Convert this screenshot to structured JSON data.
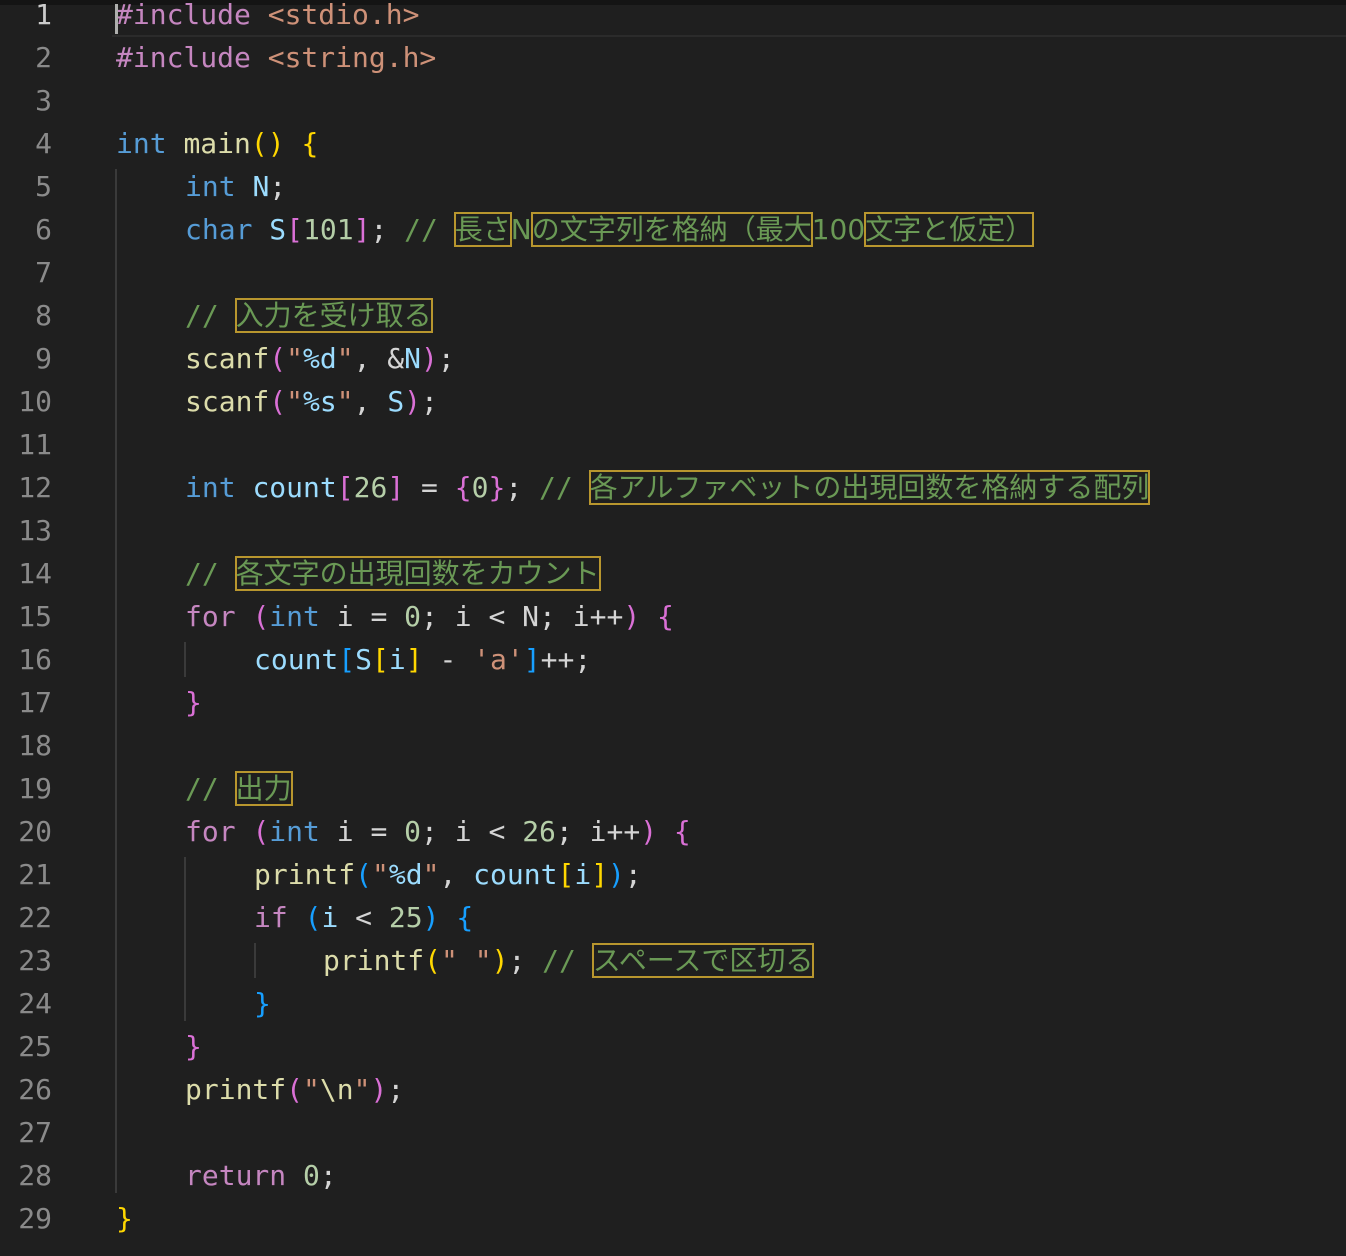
{
  "theme": {
    "background": "#1f1f1f",
    "colors": {
      "kw": "#569cd6",
      "ctl": "#c586c0",
      "fn": "#dcdcaa",
      "var": "#9cdcfe",
      "num": "#b5cea8",
      "str": "#ce9178",
      "cmt": "#6a9955",
      "pp": "#c586c0",
      "hdr": "#ce9178",
      "op": "#d4d4d4",
      "p1": "#ffd700",
      "p2": "#da70d6",
      "p3": "#179fff",
      "jp": "#6a9955"
    },
    "highlight_box": "#b8962e"
  },
  "editor": {
    "active_line": 1,
    "lines": [
      {
        "no": "1",
        "indent": 0,
        "tokens": [
          [
            "pp",
            "#include"
          ],
          [
            "op",
            " "
          ],
          [
            "hdr",
            "<stdio.h>"
          ]
        ]
      },
      {
        "no": "2",
        "indent": 0,
        "tokens": [
          [
            "pp",
            "#include"
          ],
          [
            "op",
            " "
          ],
          [
            "hdr",
            "<string.h>"
          ]
        ]
      },
      {
        "no": "3",
        "indent": 0,
        "tokens": []
      },
      {
        "no": "4",
        "indent": 0,
        "tokens": [
          [
            "kw",
            "int"
          ],
          [
            "op",
            " "
          ],
          [
            "fn",
            "main"
          ],
          [
            "p1",
            "()"
          ],
          [
            "op",
            " "
          ],
          [
            "p1",
            "{"
          ]
        ]
      },
      {
        "no": "5",
        "indent": 1,
        "tokens": [
          [
            "kw",
            "int"
          ],
          [
            "op",
            " "
          ],
          [
            "var",
            "N"
          ],
          [
            "op",
            ";"
          ]
        ]
      },
      {
        "no": "6",
        "indent": 1,
        "tokens": [
          [
            "kw",
            "char"
          ],
          [
            "op",
            " "
          ],
          [
            "var",
            "S"
          ],
          [
            "p2",
            "["
          ],
          [
            "num",
            "101"
          ],
          [
            "p2",
            "]"
          ],
          [
            "op",
            "; "
          ],
          [
            "cmt",
            "// "
          ],
          [
            "jpm",
            "長さ"
          ],
          [
            "jp",
            "N"
          ],
          [
            "jpm",
            "の文字列を格納（最大"
          ],
          [
            "jp",
            "100"
          ],
          [
            "jpm",
            "文字と仮定）"
          ]
        ]
      },
      {
        "no": "7",
        "indent": 1,
        "tokens": []
      },
      {
        "no": "8",
        "indent": 1,
        "tokens": [
          [
            "cmt",
            "// "
          ],
          [
            "jpm",
            "入力を受け取る"
          ]
        ]
      },
      {
        "no": "9",
        "indent": 1,
        "tokens": [
          [
            "fn",
            "scanf"
          ],
          [
            "p2",
            "("
          ],
          [
            "str",
            "\""
          ],
          [
            "var",
            "%d"
          ],
          [
            "str",
            "\""
          ],
          [
            "op",
            ", &"
          ],
          [
            "var",
            "N"
          ],
          [
            "p2",
            ")"
          ],
          [
            "op",
            ";"
          ]
        ]
      },
      {
        "no": "10",
        "indent": 1,
        "tokens": [
          [
            "fn",
            "scanf"
          ],
          [
            "p2",
            "("
          ],
          [
            "str",
            "\""
          ],
          [
            "var",
            "%s"
          ],
          [
            "str",
            "\""
          ],
          [
            "op",
            ", "
          ],
          [
            "var",
            "S"
          ],
          [
            "p2",
            ")"
          ],
          [
            "op",
            ";"
          ]
        ]
      },
      {
        "no": "11",
        "indent": 1,
        "tokens": []
      },
      {
        "no": "12",
        "indent": 1,
        "tokens": [
          [
            "kw",
            "int"
          ],
          [
            "op",
            " "
          ],
          [
            "var",
            "count"
          ],
          [
            "p2",
            "["
          ],
          [
            "num",
            "26"
          ],
          [
            "p2",
            "]"
          ],
          [
            "op",
            " = "
          ],
          [
            "p2",
            "{"
          ],
          [
            "num",
            "0"
          ],
          [
            "p2",
            "}"
          ],
          [
            "op",
            "; "
          ],
          [
            "cmt",
            "// "
          ],
          [
            "jpm",
            "各アルファベットの出現回数を格納する配列"
          ]
        ]
      },
      {
        "no": "13",
        "indent": 1,
        "tokens": []
      },
      {
        "no": "14",
        "indent": 1,
        "tokens": [
          [
            "cmt",
            "// "
          ],
          [
            "jpm",
            "各文字の出現回数をカウント"
          ]
        ]
      },
      {
        "no": "15",
        "indent": 1,
        "tokens": [
          [
            "ctl",
            "for"
          ],
          [
            "op",
            " "
          ],
          [
            "p2",
            "("
          ],
          [
            "kw",
            "int"
          ],
          [
            "op",
            " i = "
          ],
          [
            "num",
            "0"
          ],
          [
            "op",
            "; i < N; i++"
          ],
          [
            "p2",
            ")"
          ],
          [
            "op",
            " "
          ],
          [
            "p2",
            "{"
          ]
        ]
      },
      {
        "no": "16",
        "indent": 2,
        "tokens": [
          [
            "var",
            "count"
          ],
          [
            "p3",
            "["
          ],
          [
            "var",
            "S"
          ],
          [
            "p1",
            "["
          ],
          [
            "var",
            "i"
          ],
          [
            "p1",
            "]"
          ],
          [
            "op",
            " - "
          ],
          [
            "str",
            "'a'"
          ],
          [
            "p3",
            "]"
          ],
          [
            "op",
            "++;"
          ]
        ]
      },
      {
        "no": "17",
        "indent": 1,
        "tokens": [
          [
            "p2",
            "}"
          ]
        ]
      },
      {
        "no": "18",
        "indent": 1,
        "tokens": []
      },
      {
        "no": "19",
        "indent": 1,
        "tokens": [
          [
            "cmt",
            "// "
          ],
          [
            "jpm",
            "出力"
          ]
        ]
      },
      {
        "no": "20",
        "indent": 1,
        "tokens": [
          [
            "ctl",
            "for"
          ],
          [
            "op",
            " "
          ],
          [
            "p2",
            "("
          ],
          [
            "kw",
            "int"
          ],
          [
            "op",
            " i = "
          ],
          [
            "num",
            "0"
          ],
          [
            "op",
            "; i < "
          ],
          [
            "num",
            "26"
          ],
          [
            "op",
            "; i++"
          ],
          [
            "p2",
            ")"
          ],
          [
            "op",
            " "
          ],
          [
            "p2",
            "{"
          ]
        ]
      },
      {
        "no": "21",
        "indent": 2,
        "tokens": [
          [
            "fn",
            "printf"
          ],
          [
            "p3",
            "("
          ],
          [
            "str",
            "\""
          ],
          [
            "var",
            "%d"
          ],
          [
            "str",
            "\""
          ],
          [
            "op",
            ", "
          ],
          [
            "var",
            "count"
          ],
          [
            "p1",
            "["
          ],
          [
            "var",
            "i"
          ],
          [
            "p1",
            "]"
          ],
          [
            "p3",
            ")"
          ],
          [
            "op",
            ";"
          ]
        ]
      },
      {
        "no": "22",
        "indent": 2,
        "tokens": [
          [
            "ctl",
            "if"
          ],
          [
            "op",
            " "
          ],
          [
            "p3",
            "("
          ],
          [
            "var",
            "i"
          ],
          [
            "op",
            " < "
          ],
          [
            "num",
            "25"
          ],
          [
            "p3",
            ")"
          ],
          [
            "op",
            " "
          ],
          [
            "p3",
            "{"
          ]
        ]
      },
      {
        "no": "23",
        "indent": 3,
        "tokens": [
          [
            "fn",
            "printf"
          ],
          [
            "p1",
            "("
          ],
          [
            "str",
            "\" \""
          ],
          [
            "p1",
            ")"
          ],
          [
            "op",
            "; "
          ],
          [
            "cmt",
            "// "
          ],
          [
            "jpm",
            "スペースで区切る"
          ]
        ]
      },
      {
        "no": "24",
        "indent": 2,
        "tokens": [
          [
            "p3",
            "}"
          ]
        ]
      },
      {
        "no": "25",
        "indent": 1,
        "tokens": [
          [
            "p2",
            "}"
          ]
        ]
      },
      {
        "no": "26",
        "indent": 1,
        "tokens": [
          [
            "fn",
            "printf"
          ],
          [
            "p2",
            "("
          ],
          [
            "str",
            "\""
          ],
          [
            "fn",
            "\\n"
          ],
          [
            "str",
            "\""
          ],
          [
            "p2",
            ")"
          ],
          [
            "op",
            ";"
          ]
        ]
      },
      {
        "no": "27",
        "indent": 1,
        "tokens": []
      },
      {
        "no": "28",
        "indent": 1,
        "tokens": [
          [
            "ctl",
            "return"
          ],
          [
            "op",
            " "
          ],
          [
            "num",
            "0"
          ],
          [
            "op",
            ";"
          ]
        ]
      },
      {
        "no": "29",
        "indent": 0,
        "tokens": [
          [
            "p1",
            "}"
          ]
        ]
      }
    ]
  }
}
